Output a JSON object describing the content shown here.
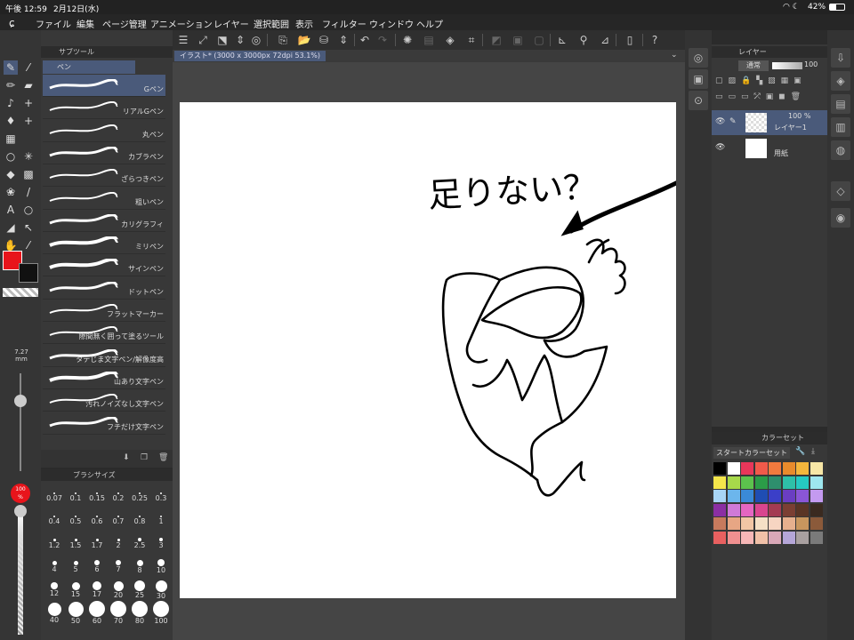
{
  "status": {
    "time": "午後 12:59",
    "date": "2月12日(水)",
    "battery": "42%"
  },
  "menu": [
    "ファイル",
    "編集",
    "ページ管理",
    "アニメーション",
    "レイヤー",
    "選択範囲",
    "表示",
    "フィルター",
    "ウィンドウ",
    "ヘルプ"
  ],
  "document": {
    "tab": "イラスト* (3000 x 3000px 72dpi 53.1%)"
  },
  "subtool": {
    "tab": "サブツール",
    "group": "ペン",
    "brushes": [
      "Gペン",
      "リアルGペン",
      "丸ペン",
      "カブラペン",
      "ざらつきペン",
      "粗いペン",
      "カリグラフィ",
      "ミリペン",
      "サインペン",
      "ドットペン",
      "フラットマーカー",
      "隙間無く囲って塗るツール",
      "タテじま文字ペン/解像度高",
      "山あり文字ペン",
      "汚れノイズなし文字ペン",
      "フチだけ文字ペン"
    ]
  },
  "brush_size": {
    "tab": "ブラシサイズ",
    "current_value": "7.27",
    "current_unit": "mm",
    "opacity_value": "100",
    "opacity_unit": "%",
    "values": [
      "0.07",
      "0.1",
      "0.15",
      "0.2",
      "0.25",
      "0.3",
      "0.4",
      "0.5",
      "0.6",
      "0.7",
      "0.8",
      "1",
      "1.2",
      "1.5",
      "1.7",
      "2",
      "2.5",
      "3",
      "4",
      "5",
      "6",
      "7",
      "8",
      "10",
      "12",
      "15",
      "17",
      "20",
      "25",
      "30",
      "40",
      "50",
      "60",
      "70",
      "80",
      "100"
    ]
  },
  "layers": {
    "tab": "レイヤー",
    "blend_mode": "通常",
    "opacity": "100",
    "items": [
      {
        "name": "レイヤー1",
        "opacity": "100 %"
      },
      {
        "name": "用紙"
      }
    ]
  },
  "color_set": {
    "tab": "カラーセット",
    "set_name": "スタートカラーセット",
    "swatches": [
      "#000000",
      "#ffffff",
      "#e8375a",
      "#f15a4a",
      "#f27a3e",
      "#e98b2c",
      "#f5b63c",
      "#f7e7a6",
      "#f4e64b",
      "#a7d94a",
      "#5cc24d",
      "#2b9c48",
      "#2e8f6d",
      "#2ec0a8",
      "#26c9c2",
      "#9ee7ef",
      "#a8d5f5",
      "#6cb6ec",
      "#3a8ad8",
      "#1f4db3",
      "#3b3fc8",
      "#6a3ec2",
      "#8a56d6",
      "#c49af0",
      "#8b2fa3",
      "#cf7ad8",
      "#e466c2",
      "#d9458f",
      "#a43b52",
      "#7b3f33",
      "#5a3525",
      "#3a2a20",
      "#c77a5d",
      "#e7a684",
      "#f2c6a5",
      "#f5e0c6",
      "#f7d5c2",
      "#e6b08e",
      "#c8965e",
      "#8b5a3a",
      "#e86060",
      "#f09090",
      "#f7b7b7",
      "#f1c1a8",
      "#d9a8b8",
      "#b5a6d8",
      "#a9a0a0",
      "#7a7a7a"
    ]
  },
  "canvas_text": "足りない？",
  "colors": {
    "main": "#e8141b",
    "sub": "#111111",
    "accent": "#4a5a7a"
  }
}
